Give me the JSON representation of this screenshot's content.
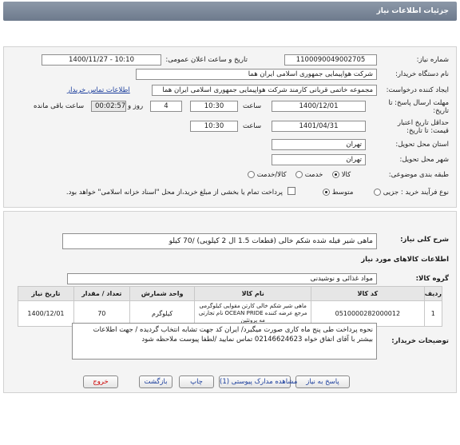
{
  "header": {
    "title": "جزئیات اطلاعات نیاز"
  },
  "fields": {
    "need_number_label": "شماره نیاز:",
    "need_number": "1100090049002705",
    "announce_label": "تاریخ و ساعت اعلان عمومی:",
    "announce_value": "1400/11/27 - 10:10",
    "buyer_label": "نام دستگاه خریدار:",
    "buyer": "شرکت هواپیمایی جمهوری اسلامی ایران هما",
    "creator_label": "ایجاد کننده درخواست:",
    "creator": "مجموعه خاتمی قربانی کارمند شرکت هواپیمایی جمهوری اسلامی ایران هما",
    "contact_link": "اطلاعات تماس خریدار",
    "deadline_label": "مهلت ارسال پاسخ: تا تاریخ:",
    "deadline_date": "1400/12/01",
    "time_label": "ساعت",
    "deadline_time": "10:30",
    "days_value": "4",
    "days_label": "روز و",
    "remaining_time": "00:02:57",
    "remaining_label": "ساعت باقی مانده",
    "validity_label": "حداقل تاریخ اعتبار قیمت: تا تاریخ:",
    "validity_date": "1401/04/31",
    "validity_time": "10:30",
    "province_label": "استان محل تحویل:",
    "province": "تهران",
    "city_label": "شهر محل تحویل:",
    "city": "تهران",
    "category_label": "طبقه بندی موضوعی:",
    "category_options": [
      "کالا",
      "خدمت",
      "کالا/خدمت"
    ],
    "category_selected": "کالا",
    "process_label": "نوع فرآیند خرید :",
    "process_options": [
      "جزیی",
      "متوسط"
    ],
    "process_selected": "متوسط",
    "payment_note": "پرداخت تمام یا بخشی از مبلغ خرید،از محل \"اسناد خزانه اسلامی\" خواهد بود."
  },
  "need": {
    "summary_label": "شرح کلی نیاز:",
    "summary": "ماهی شیر فیله شده شکم خالی (قطعات 1.5 ال 2 کیلویی) /70 کیلو",
    "goods_info_title": "اطلاعات کالاهای مورد نیاز",
    "group_label": "گروه کالا:",
    "group": "مواد غذائی و نوشیدنی",
    "table": {
      "headers": [
        "ردیف",
        "کد کالا",
        "نام کالا",
        "واحد شمارش",
        "تعداد / مقدار",
        "تاریخ نیاز"
      ],
      "rows": [
        [
          "1",
          "0510000282000012",
          "ماهی شیر شکم خالی کارتن مقوایی کیلوگرمی نام تجارتی OCEAN PRIDE مرجع عرضه کننده مه پروتئین",
          "کیلوگرم",
          "70",
          "1400/12/01"
        ]
      ]
    },
    "buyer_notes_label": "توضیحات خریدار:",
    "buyer_notes": "نحوه پرداخت طی پنج ماه کاری صورت میگیرد/ ایران کد جهت تشابه انتخاب گردیده / جهت اطلاعات بیشتر با آقای اتفاق خواه 02146624623 تماس نمایید /لطفا پیوست ملاحظه شود"
  },
  "buttons": {
    "reply": "پاسخ به نیاز",
    "attachments": "مشاهده مدارک پیوستی (1)",
    "print": "چاپ",
    "back": "بازگشت",
    "exit": "خروج"
  },
  "colors": {
    "title_bar": "#7a8698",
    "link": "#1a3d9c",
    "exit_text": "#cc0000"
  }
}
